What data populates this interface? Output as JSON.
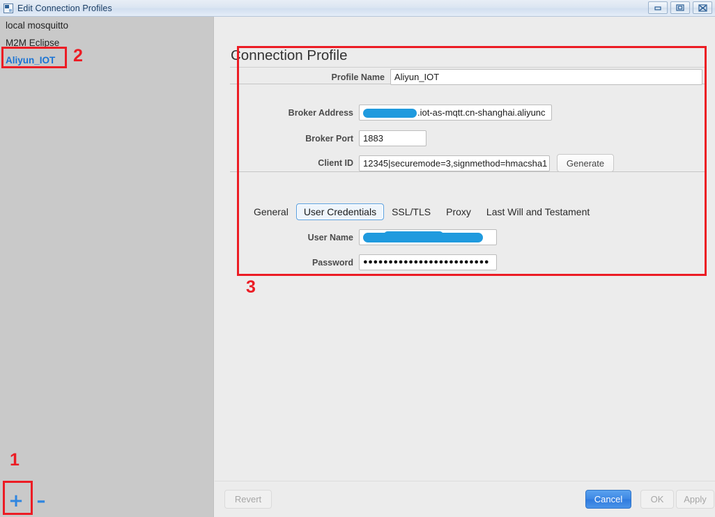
{
  "window": {
    "title": "Edit Connection Profiles",
    "icon": "app-icon",
    "controls": {
      "minimize": "minimize-icon",
      "maximize": "maximize-icon",
      "close": "close-icon"
    }
  },
  "sidebar": {
    "profiles": [
      {
        "label": "local mosquitto",
        "selected": false
      },
      {
        "label": "M2M Eclipse",
        "selected": false
      },
      {
        "label": "Aliyun_IOT",
        "selected": true
      }
    ],
    "toolbar": {
      "add_label": "+",
      "remove_label": "–"
    }
  },
  "main": {
    "title": "Connection Profile",
    "fields": {
      "profile_name": {
        "label": "Profile Name",
        "value": "Aliyun_IOT"
      },
      "broker_address": {
        "label": "Broker Address",
        "value": ".iot-as-mqtt.cn-shanghai.aliyunc",
        "redacted": true
      },
      "broker_port": {
        "label": "Broker Port",
        "value": "1883"
      },
      "client_id": {
        "label": "Client ID",
        "value": "12345|securemode=3,signmethod=hmacsha1"
      },
      "generate_button": "Generate"
    },
    "tabs": [
      {
        "label": "General",
        "active": false
      },
      {
        "label": "User Credentials",
        "active": true
      },
      {
        "label": "SSL/TLS",
        "active": false
      },
      {
        "label": "Proxy",
        "active": false
      },
      {
        "label": "Last Will and Testament",
        "active": false
      }
    ],
    "credentials": {
      "user_name": {
        "label": "User Name",
        "value": "",
        "redacted": true
      },
      "password": {
        "label": "Password",
        "value": "●●●●●●●●●●●●●●●●●●●●●●●●●"
      }
    }
  },
  "footer": {
    "revert": "Revert",
    "cancel": "Cancel",
    "ok": "OK",
    "apply": "Apply"
  },
  "annotations": [
    {
      "number": "1",
      "target": "add-profile-button"
    },
    {
      "number": "2",
      "target": "selected-profile-item"
    },
    {
      "number": "3",
      "target": "connection-profile-form"
    }
  ],
  "colors": {
    "accent_blue": "#2f86e0",
    "annotation_red": "#ec1c24",
    "redaction_blue": "#1f9ade",
    "sidebar_bg": "#c9c9c9",
    "panel_bg": "#ececec",
    "cancel_button": "#3d87e4"
  }
}
